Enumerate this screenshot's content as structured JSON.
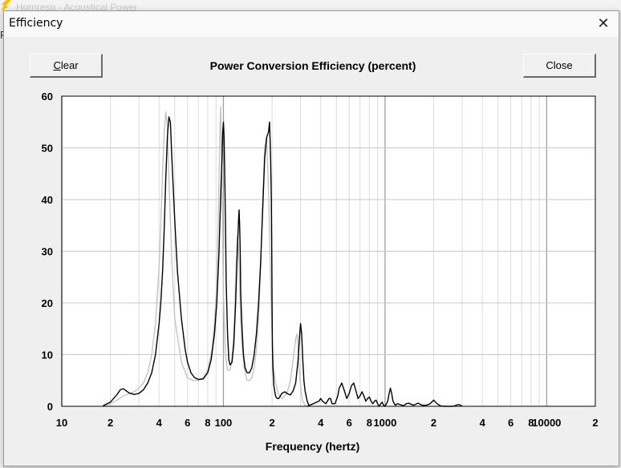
{
  "background_window": {
    "title": "Hornresp - Acoustical Power",
    "menu_letter": "F"
  },
  "dialog": {
    "title": "Efficiency",
    "close_glyph": "✕",
    "clear_underlined": "C",
    "clear_rest": "lear",
    "close_button": "Close"
  },
  "chart_data": {
    "type": "line",
    "title": "Power Conversion Efficiency (percent)",
    "xlabel": "Frequency (hertz)",
    "ylabel": "",
    "xscale": "log",
    "xlim": [
      10,
      20000
    ],
    "ylim": [
      0,
      60
    ],
    "yticks": [
      0,
      10,
      20,
      30,
      40,
      50,
      60
    ],
    "xticks": [
      {
        "v": 10,
        "label": "10"
      },
      {
        "v": 20,
        "label": "2"
      },
      {
        "v": 40,
        "label": "4"
      },
      {
        "v": 60,
        "label": "6"
      },
      {
        "v": 80,
        "label": "8"
      },
      {
        "v": 100,
        "label": "100"
      },
      {
        "v": 200,
        "label": "2"
      },
      {
        "v": 400,
        "label": "4"
      },
      {
        "v": 600,
        "label": "6"
      },
      {
        "v": 800,
        "label": "8"
      },
      {
        "v": 1000,
        "label": "1000"
      },
      {
        "v": 2000,
        "label": "2"
      },
      {
        "v": 4000,
        "label": "4"
      },
      {
        "v": 6000,
        "label": "6"
      },
      {
        "v": 8000,
        "label": "8"
      },
      {
        "v": 10000,
        "label": "10000"
      },
      {
        "v": 20000,
        "label": "2"
      }
    ],
    "grid": true,
    "series": [
      {
        "color": "#c4c4c4",
        "x": [
          18,
          20,
          22,
          24,
          26,
          28,
          30,
          32,
          34,
          36,
          38,
          40,
          41,
          42,
          43,
          44,
          45,
          46,
          48,
          50,
          55,
          60,
          65,
          70,
          75,
          80,
          85,
          88,
          91,
          93,
          95,
          96,
          97,
          98,
          100,
          103,
          106,
          110,
          113,
          116,
          118,
          120,
          122,
          124,
          126,
          128,
          130,
          135,
          140,
          145,
          150,
          155,
          160,
          165,
          170,
          175,
          180,
          185,
          190,
          193,
          196,
          199,
          202,
          205,
          210,
          220,
          230,
          240,
          250,
          260,
          270,
          280,
          285,
          290,
          295,
          300,
          305,
          310,
          320,
          330
        ],
        "values": [
          0.1,
          0.5,
          1.2,
          2.0,
          2.4,
          2.8,
          3.5,
          4.5,
          6.5,
          10,
          16,
          27,
          35,
          45,
          53,
          57,
          54,
          44,
          28,
          17,
          8.5,
          5.5,
          5.0,
          5.0,
          5.5,
          7,
          11,
          16,
          24,
          37,
          52,
          58,
          52,
          40,
          22,
          10,
          7,
          7,
          9,
          14,
          20,
          28,
          33,
          30,
          24,
          17,
          12,
          7,
          5,
          5,
          5.5,
          7.5,
          11,
          17,
          27,
          40,
          50,
          52,
          42,
          33,
          24,
          16,
          10,
          7,
          4.5,
          2.2,
          1.5,
          2.0,
          3.0,
          5,
          9,
          13,
          14,
          11,
          7,
          4,
          2,
          1,
          0.2,
          0
        ]
      },
      {
        "color": "#000000",
        "x": [
          18,
          20,
          22,
          23,
          24,
          25,
          26,
          28,
          30,
          32,
          34,
          36,
          38,
          40,
          41,
          42,
          43,
          44,
          45,
          46,
          47,
          48,
          50,
          52,
          55,
          58,
          60,
          63,
          66,
          70,
          75,
          80,
          84,
          88,
          91,
          94,
          96,
          98,
          99,
          100,
          101,
          102,
          103,
          104,
          106,
          108,
          110,
          113,
          116,
          119,
          122,
          124,
          125,
          126,
          127,
          128,
          130,
          133,
          136,
          140,
          145,
          150,
          155,
          160,
          165,
          170,
          175,
          180,
          185,
          190,
          193,
          196,
          198,
          199,
          200,
          201,
          202,
          205,
          210,
          215,
          220,
          225,
          230,
          240,
          250,
          260,
          270,
          280,
          290,
          295,
          300,
          305,
          310,
          315,
          320,
          330,
          340
        ],
        "values": [
          0.1,
          0.8,
          2.3,
          3.2,
          3.4,
          3.0,
          2.6,
          2.3,
          2.5,
          3.2,
          4.5,
          6.5,
          10,
          16,
          20,
          26,
          34,
          44,
          52,
          56,
          55,
          48,
          36,
          26,
          17,
          11,
          8.5,
          6.5,
          5.6,
          5.2,
          5.3,
          6.5,
          9,
          14,
          20,
          30,
          40,
          48,
          53,
          55,
          52,
          44,
          36,
          24,
          14,
          9,
          8,
          8.5,
          12,
          20,
          30,
          36,
          38,
          35,
          30,
          22,
          16,
          10,
          7.5,
          6.5,
          6.5,
          7.5,
          10,
          14,
          20,
          28,
          38,
          48,
          52,
          53,
          55,
          48,
          40,
          30,
          20,
          12,
          8,
          4,
          2,
          1.5,
          1.5,
          2,
          2.5,
          2.8,
          2.4,
          2.2,
          3.0,
          4.5,
          9,
          13,
          16,
          14,
          9,
          5,
          3,
          1,
          0
        ]
      },
      {
        "color": "#000000",
        "x": [
          330,
          360,
          390,
          400,
          410,
          430,
          440,
          450,
          460,
          470,
          490,
          510,
          520,
          540,
          560,
          580,
          600,
          620,
          640,
          660,
          680,
          700,
          720,
          740,
          760,
          780,
          800,
          820,
          840,
          860,
          880,
          900,
          920,
          940,
          960,
          980,
          1000,
          1020,
          1040,
          1060,
          1080,
          1100,
          1120,
          1140,
          1160,
          1180,
          1200,
          1250,
          1300,
          1350,
          1400,
          1500,
          1600,
          1700,
          1800,
          1900,
          2000,
          2100,
          2200,
          2300,
          2400,
          2500,
          2600,
          2700,
          2800,
          2900,
          3000
        ],
        "values": [
          0,
          0.5,
          1,
          1.5,
          1,
          0.5,
          1,
          1.5,
          1.5,
          0.5,
          0.5,
          2,
          3.5,
          4.5,
          3,
          1.5,
          2.5,
          4,
          4.5,
          3,
          1.5,
          2,
          2.8,
          2,
          1,
          1.5,
          1.8,
          1,
          0.5,
          1,
          1.2,
          0.5,
          0,
          0.5,
          0.8,
          0.2,
          0,
          0.5,
          1,
          2.5,
          3.5,
          2.5,
          1,
          0.5,
          0.2,
          0.4,
          0.5,
          0.3,
          0.1,
          0.5,
          0.6,
          0.2,
          0.6,
          0.2,
          0.2,
          0.5,
          1.2,
          0.5,
          0.1,
          0,
          0,
          0,
          0,
          0.1,
          0.3,
          0.3,
          0
        ]
      }
    ]
  }
}
